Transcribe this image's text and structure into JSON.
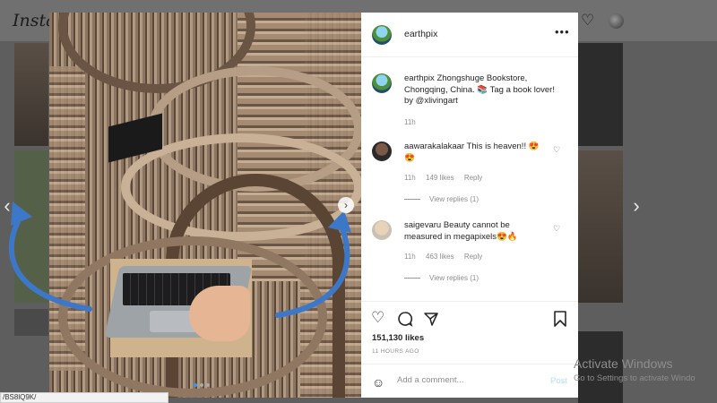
{
  "background": {
    "logo": "Insta"
  },
  "post": {
    "username": "earthpix",
    "caption_text": "Zhongshuge Bookstore, Chongqing, China. 📚 Tag a book lover! by @xlivingart",
    "caption_time": "11h",
    "comments": [
      {
        "username": "aawarakalakaar",
        "text": "This is heaven!! 😍😍",
        "time": "11h",
        "likes": "149 likes",
        "reply_label": "Reply",
        "view_replies": "View replies (1)"
      },
      {
        "username": "saigevaru",
        "text": "Beauty cannot be measured in megapixels😍🔥",
        "time": "11h",
        "likes": "463 likes",
        "reply_label": "Reply",
        "view_replies": "View replies (1)"
      }
    ],
    "like_count": "151,130 likes",
    "time_ago": "11 HOURS AGO",
    "comment_placeholder": "Add a comment...",
    "post_button": "Post"
  },
  "icons": {
    "more": "more-options-icon",
    "like": "heart-icon",
    "comment": "comment-icon",
    "share": "share-icon",
    "save": "bookmark-icon",
    "emoji": "emoji-icon"
  },
  "colors": {
    "accent_blue": "#3897f0",
    "post_disabled": "#b2dffc",
    "overlay_arrow": "#3d78c8"
  },
  "windows": {
    "activate_title": "Activate Windows",
    "activate_sub": "Go to Settings to activate Windo"
  },
  "status_url": "/BS8lQ9K/"
}
